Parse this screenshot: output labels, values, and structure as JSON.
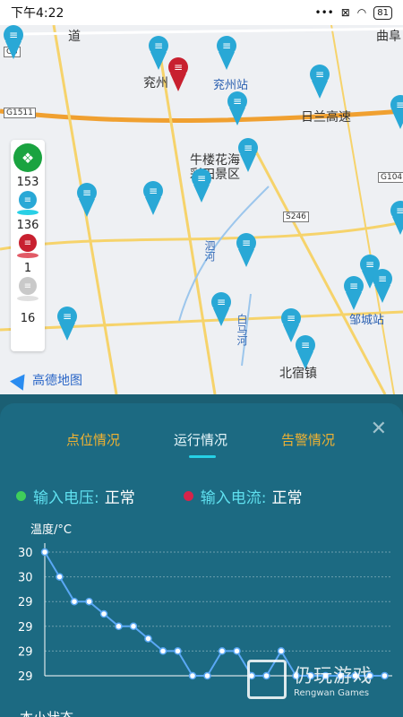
{
  "status_bar": {
    "time": "下午4:22",
    "battery": "81"
  },
  "map": {
    "places": [
      "兖州",
      "兖州站",
      "日兰高速",
      "牛楼花海",
      "彩田景区",
      "泗河",
      "白马河",
      "邹城站",
      "北宿镇",
      "曲阜",
      "道"
    ],
    "road_tags": [
      "G104",
      "S246",
      "G1511",
      "G3"
    ],
    "provider": "高德地图"
  },
  "legend": {
    "counts": [
      "153",
      "136",
      "1",
      "16"
    ],
    "colors": {
      "normal": "#29a8d6",
      "alarm": "#c8202f",
      "offline": "#c9c9c9"
    }
  },
  "panel": {
    "tabs": [
      "点位情况",
      "运行情况",
      "告警情况"
    ],
    "active_tab": "运行情况",
    "voltage_label": "输入电压:",
    "voltage_value": "正常",
    "current_label": "输入电流:",
    "current_value": "正常",
    "next_section_partial": "本小状态"
  },
  "chart_data": {
    "type": "line",
    "ylabel": "温度/°C",
    "ytick_labels": [
      "30",
      "30",
      "29",
      "29",
      "29",
      "29"
    ],
    "values": [
      30.0,
      29.8,
      29.6,
      29.6,
      29.5,
      29.4,
      29.4,
      29.3,
      29.2,
      29.2,
      29.0,
      29.0,
      29.2,
      29.2,
      29.0,
      29.0,
      29.2,
      29.0,
      29.0,
      29.0,
      29.0,
      29.0,
      29.0,
      29.0
    ],
    "ylim": [
      29.0,
      30.0
    ],
    "line_color": "#5aa8f5",
    "grid": true
  },
  "watermark": {
    "title": "仍玩游戏",
    "subtitle": "Rengwan Games"
  }
}
